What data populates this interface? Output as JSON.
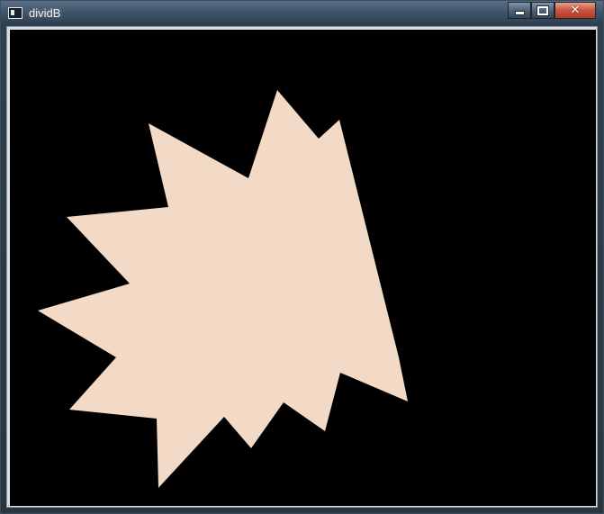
{
  "window": {
    "title": "dividB",
    "controls": {
      "minimize_icon": "minimize-icon",
      "maximize_icon": "maximize-icon",
      "close_label": "✕"
    }
  },
  "canvas": {
    "background": "#000000",
    "shape": {
      "kind": "star-polygon",
      "fill": "#f2dac7"
    }
  }
}
